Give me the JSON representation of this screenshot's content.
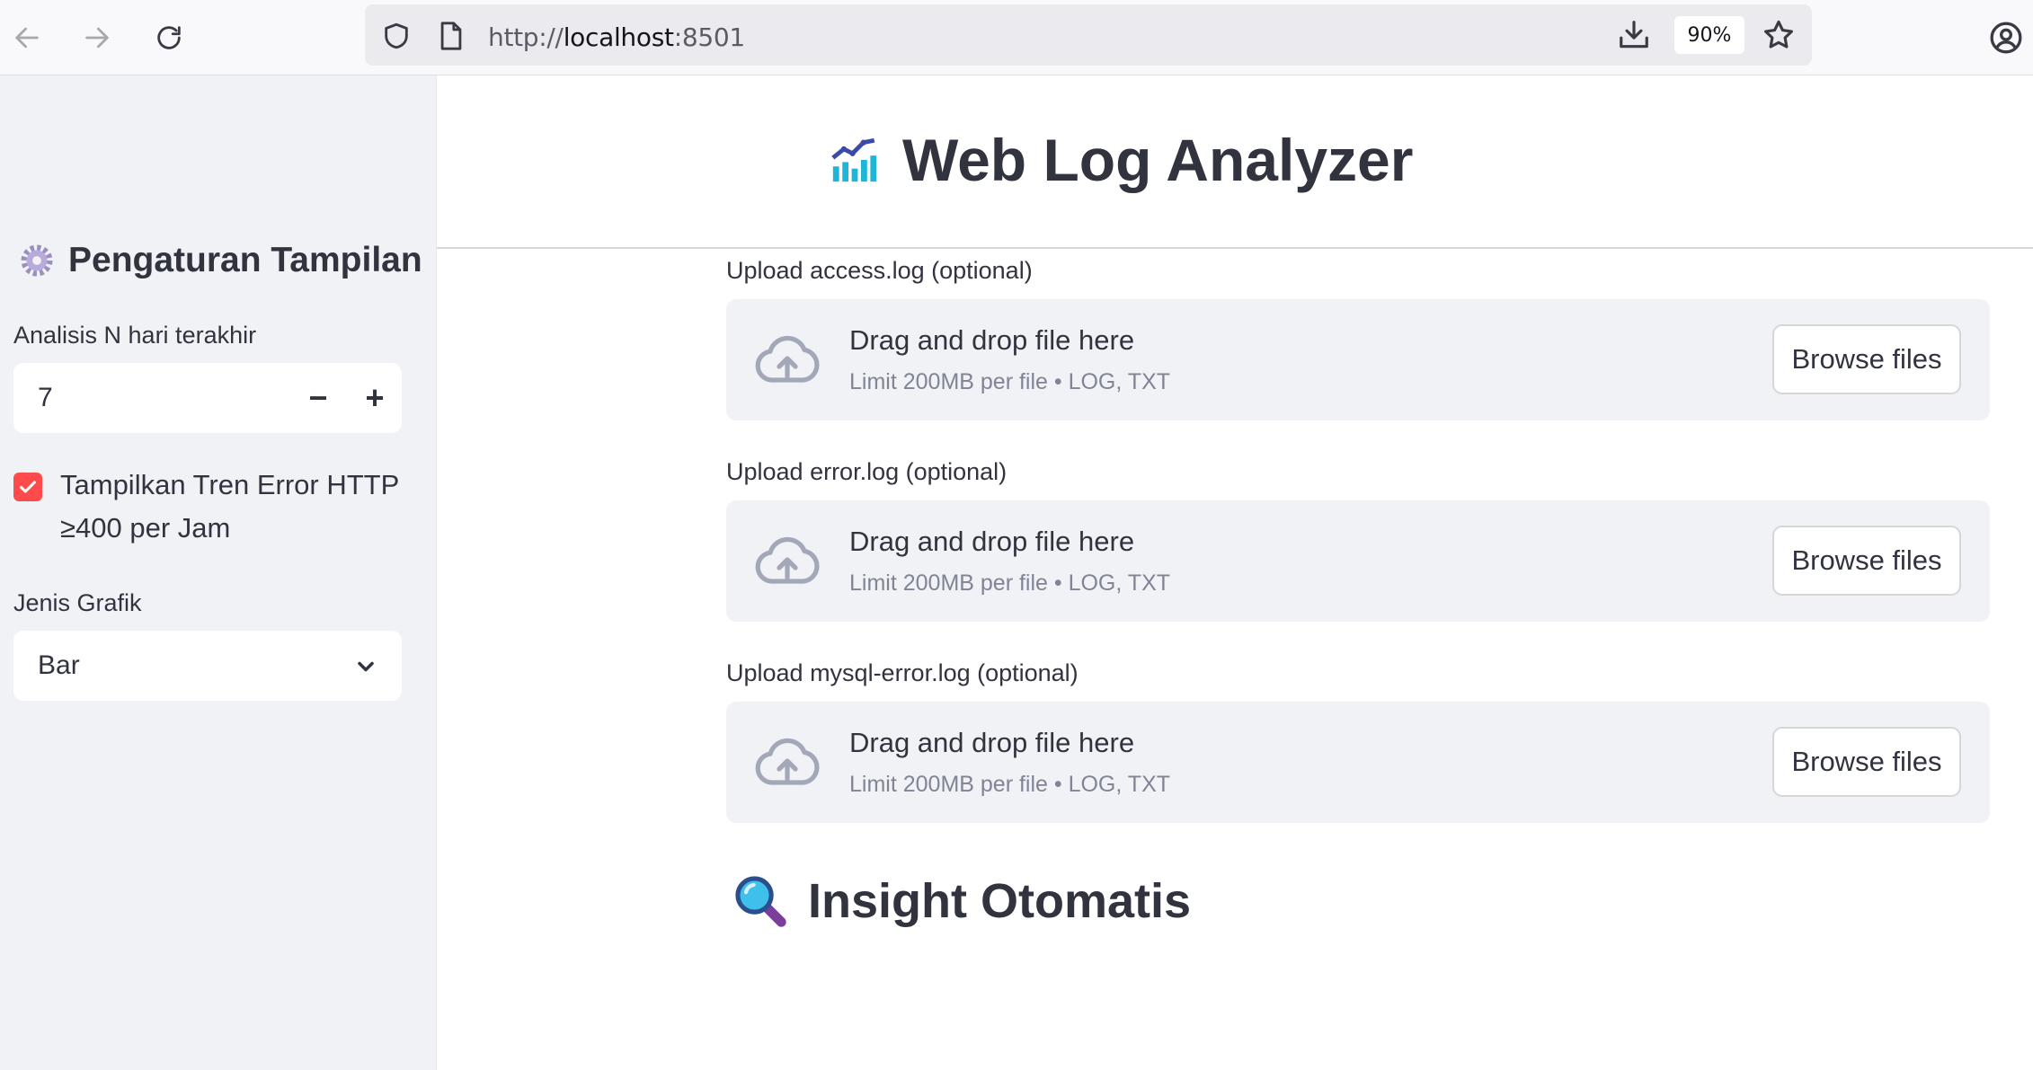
{
  "browser": {
    "url_scheme": "http://",
    "url_host": "localhost",
    "url_port": ":8501",
    "zoom": "90%"
  },
  "sidebar": {
    "header_icon": "gear-icon",
    "header": "Pengaturan Tampilan",
    "days_label": "Analisis N hari terakhir",
    "days_value": "7",
    "decrement": "−",
    "increment": "+",
    "trend_checkbox_label": "Tampilkan Tren Error HTTP ≥400 per Jam",
    "trend_checked": true,
    "chart_type_label": "Jenis Grafik",
    "chart_type_value": "Bar"
  },
  "main": {
    "title_icon": "chart-increasing-icon",
    "title": "Web Log Analyzer",
    "uploaders": [
      {
        "label": "Upload access.log (optional)",
        "drop_text": "Drag and drop file here",
        "limit_text": "Limit 200MB per file • LOG, TXT",
        "button": "Browse files"
      },
      {
        "label": "Upload error.log (optional)",
        "drop_text": "Drag and drop file here",
        "limit_text": "Limit 200MB per file • LOG, TXT",
        "button": "Browse files"
      },
      {
        "label": "Upload mysql-error.log (optional)",
        "drop_text": "Drag and drop file here",
        "limit_text": "Limit 200MB per file • LOG, TXT",
        "button": "Browse files"
      }
    ],
    "insight_icon": "magnifying-glass-icon",
    "insight_title": "Insight Otomatis"
  },
  "colors": {
    "accent": "#ff4b4b",
    "sidebar_bg": "#f0f2f6",
    "text": "#31333f",
    "muted": "#808495"
  }
}
